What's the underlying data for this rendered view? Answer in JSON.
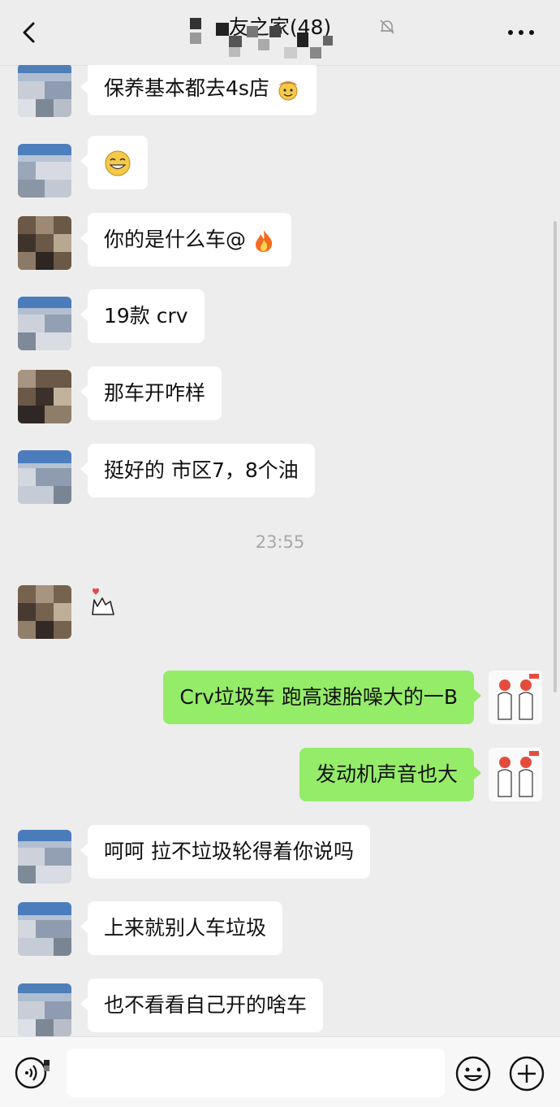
{
  "header": {
    "title": "友之家(48)",
    "back_icon": "chevron-left-icon",
    "mute_icon": "bell-off-icon",
    "more_icon": "more-dots-icon"
  },
  "messages": [
    {
      "side": "left",
      "text": "保养基本都去4s店",
      "trailing_emoji": "cowboy-face"
    },
    {
      "side": "left",
      "text": "",
      "emoji": "grinning-face"
    },
    {
      "side": "left",
      "text": "你的是什么车@",
      "trailing_emoji": "fire"
    },
    {
      "side": "left",
      "text": "19款 crv"
    },
    {
      "side": "left",
      "text": "那车开咋样"
    },
    {
      "side": "left",
      "text": "挺好的 市区7，8个油"
    },
    {
      "timestamp": "23:55"
    },
    {
      "side": "left",
      "sticker": "heart-hand-sticker"
    },
    {
      "side": "right",
      "text": "Crv垃圾车 跑高速胎噪大的一B"
    },
    {
      "side": "right",
      "text": "发动机声音也大"
    },
    {
      "side": "left",
      "text": "呵呵 拉不垃圾轮得着你说吗"
    },
    {
      "side": "left",
      "text": "上来就别人车垃圾"
    },
    {
      "side": "left",
      "text": "也不看看自己开的啥车"
    }
  ],
  "input_bar": {
    "voice_icon": "voice-icon",
    "input_value": "",
    "emoji_icon": "smiley-icon",
    "plus_icon": "plus-circle-icon"
  },
  "colors": {
    "background": "#ededed",
    "bubble_left": "#ffffff",
    "bubble_right": "#95ec69",
    "timestamp": "#a8a8a8"
  }
}
